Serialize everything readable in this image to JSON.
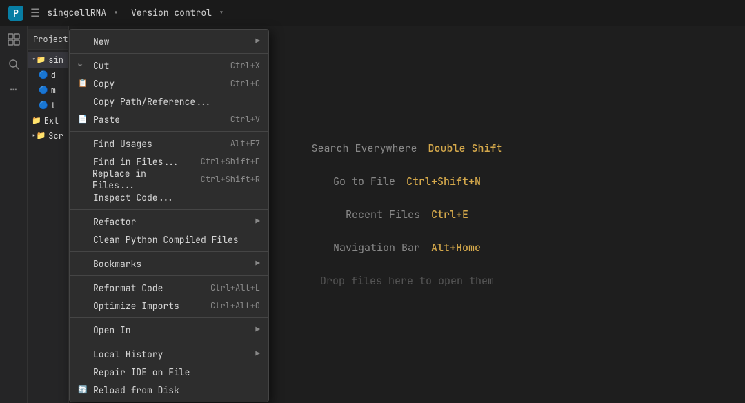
{
  "titlebar": {
    "logo_alt": "IDE Logo",
    "menu_icon": "☰",
    "project_name": "singcellRNA",
    "project_dropdown": "▾",
    "separator": "",
    "vcs_label": "Version control",
    "vcs_dropdown": "▾"
  },
  "sidebar": {
    "icons": [
      "⊞",
      "◉",
      "⋯"
    ]
  },
  "project_panel": {
    "title": "Project",
    "title_icon": "▾",
    "tree_items": [
      {
        "label": "sin",
        "icon": "📁",
        "indent": 0,
        "selected": true
      },
      {
        "label": "d",
        "icon": "🔵",
        "indent": 1
      },
      {
        "label": "m",
        "icon": "🔵",
        "indent": 1
      },
      {
        "label": "t",
        "icon": "🔵",
        "indent": 1
      },
      {
        "label": "Ext",
        "icon": "📁",
        "indent": 0
      },
      {
        "label": "Scr",
        "icon": "📁",
        "indent": 0
      }
    ]
  },
  "context_menu": {
    "items": [
      {
        "type": "item",
        "label": "New",
        "icon": "",
        "shortcut": "",
        "arrow": "▶",
        "underline": ""
      },
      {
        "type": "separator"
      },
      {
        "type": "item",
        "label": "Cut",
        "icon": "✂",
        "shortcut": "Ctrl+X",
        "arrow": "",
        "underline": "C"
      },
      {
        "type": "item",
        "label": "Copy",
        "icon": "📋",
        "shortcut": "Ctrl+C",
        "arrow": "",
        "underline": "C"
      },
      {
        "type": "item",
        "label": "Copy Path/Reference...",
        "icon": "",
        "shortcut": "",
        "arrow": "",
        "underline": ""
      },
      {
        "type": "item",
        "label": "Paste",
        "icon": "📄",
        "shortcut": "Ctrl+V",
        "arrow": "",
        "underline": "P"
      },
      {
        "type": "separator"
      },
      {
        "type": "item",
        "label": "Find Usages",
        "icon": "",
        "shortcut": "Alt+F7",
        "arrow": "",
        "underline": "U"
      },
      {
        "type": "item",
        "label": "Find in Files...",
        "icon": "",
        "shortcut": "Ctrl+Shift+F",
        "arrow": "",
        "underline": "i"
      },
      {
        "type": "item",
        "label": "Replace in Files...",
        "icon": "",
        "shortcut": "Ctrl+Shift+R",
        "arrow": "",
        "underline": "p"
      },
      {
        "type": "item",
        "label": "Inspect Code...",
        "icon": "",
        "shortcut": "",
        "arrow": "",
        "underline": ""
      },
      {
        "type": "separator"
      },
      {
        "type": "item",
        "label": "Refactor",
        "icon": "",
        "shortcut": "",
        "arrow": "▶",
        "underline": ""
      },
      {
        "type": "item",
        "label": "Clean Python Compiled Files",
        "icon": "",
        "shortcut": "",
        "arrow": "",
        "underline": ""
      },
      {
        "type": "separator"
      },
      {
        "type": "item",
        "label": "Bookmarks",
        "icon": "",
        "shortcut": "",
        "arrow": "▶",
        "underline": ""
      },
      {
        "type": "separator"
      },
      {
        "type": "item",
        "label": "Reformat Code",
        "icon": "",
        "shortcut": "Ctrl+Alt+L",
        "arrow": "",
        "underline": ""
      },
      {
        "type": "item",
        "label": "Optimize Imports",
        "icon": "",
        "shortcut": "Ctrl+Alt+O",
        "arrow": "",
        "underline": ""
      },
      {
        "type": "separator"
      },
      {
        "type": "item",
        "label": "Open In",
        "icon": "",
        "shortcut": "",
        "arrow": "▶",
        "underline": ""
      },
      {
        "type": "separator"
      },
      {
        "type": "item",
        "label": "Local History",
        "icon": "",
        "shortcut": "",
        "arrow": "▶",
        "underline": "H"
      },
      {
        "type": "item",
        "label": "Repair IDE on File",
        "icon": "",
        "shortcut": "",
        "arrow": "",
        "underline": ""
      },
      {
        "type": "item",
        "label": "Reload from Disk",
        "icon": "🔄",
        "shortcut": "",
        "arrow": "",
        "underline": ""
      }
    ]
  },
  "main_content": {
    "shortcuts": [
      {
        "action": "Search Everywhere",
        "key": "Double Shift"
      },
      {
        "action": "Go to File",
        "key": "Ctrl+Shift+N"
      },
      {
        "action": "Recent Files",
        "key": "Ctrl+E"
      },
      {
        "action": "Navigation Bar",
        "key": "Alt+Home"
      }
    ],
    "drop_text": "Drop files here to open them"
  }
}
